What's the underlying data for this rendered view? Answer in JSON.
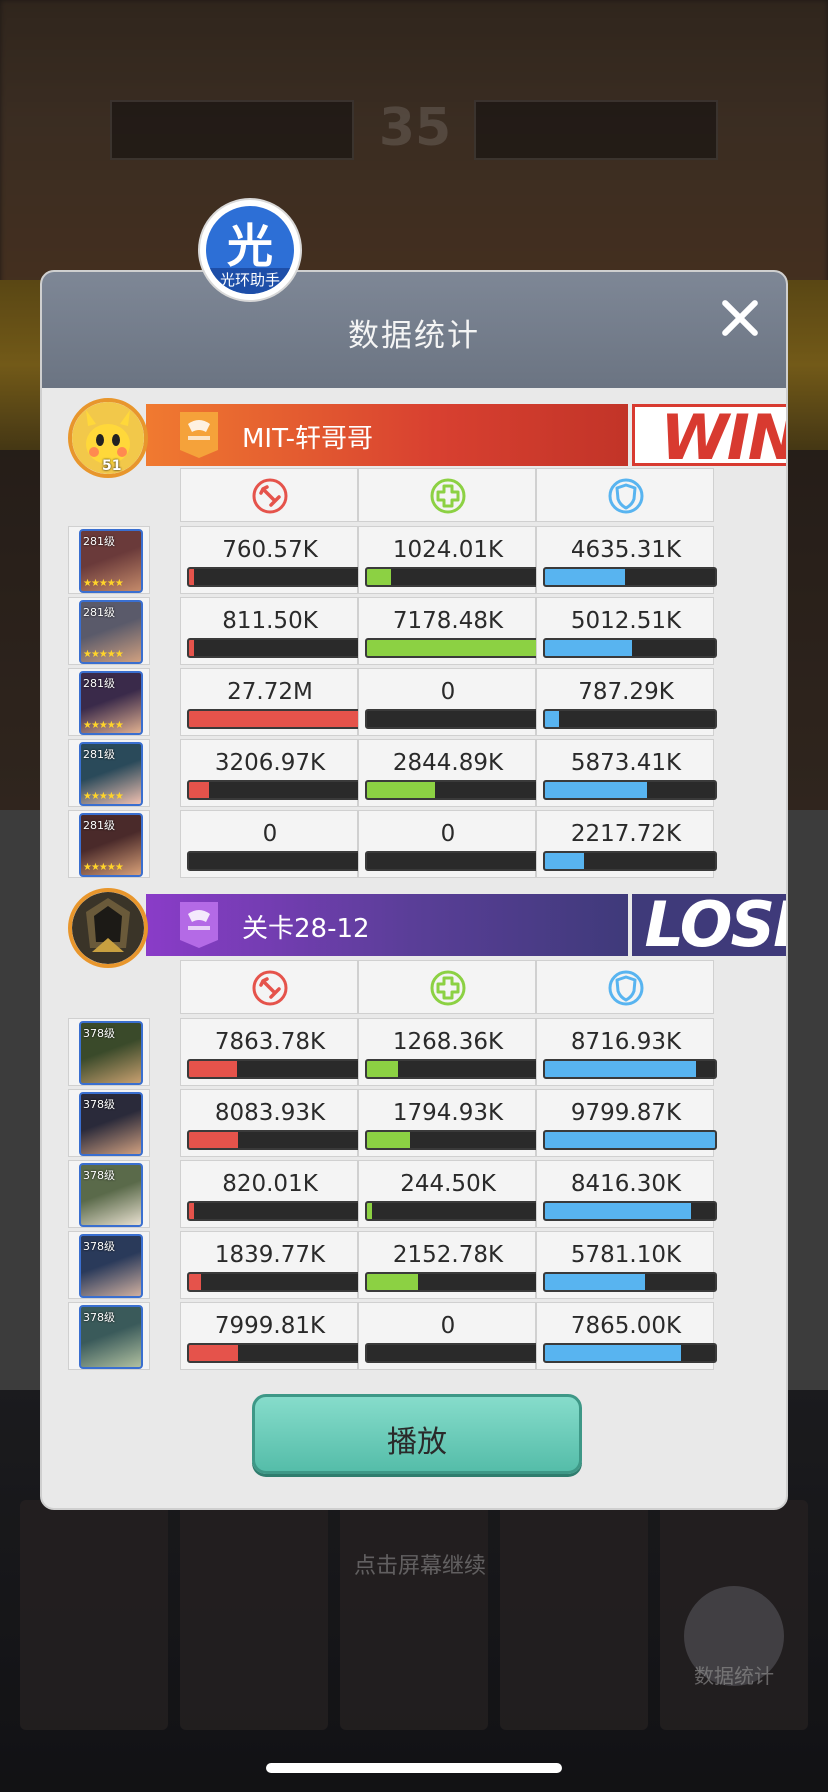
{
  "background": {
    "score": "35",
    "hint": "点击屏幕继续",
    "stats_button_label": "数据统计"
  },
  "badge": {
    "char": "光",
    "label": "光环助手"
  },
  "dialog": {
    "title": "数据统计"
  },
  "team1": {
    "name": "MIT-轩哥哥",
    "level": "51",
    "result": "WIN",
    "color": "#d84030",
    "rows": [
      {
        "level": "281级",
        "dmg": "760.57K",
        "dmg_frac": 0.03,
        "heal": "1024.01K",
        "heal_frac": 0.14,
        "def": "4635.31K",
        "def_frac": 0.47
      },
      {
        "level": "281级",
        "dmg": "811.50K",
        "dmg_frac": 0.03,
        "heal": "7178.48K",
        "heal_frac": 1.0,
        "def": "5012.51K",
        "def_frac": 0.51
      },
      {
        "level": "281级",
        "dmg": "27.72M",
        "dmg_frac": 1.0,
        "heal": "0",
        "heal_frac": 0,
        "def": "787.29K",
        "def_frac": 0.08
      },
      {
        "level": "281级",
        "dmg": "3206.97K",
        "dmg_frac": 0.12,
        "heal": "2844.89K",
        "heal_frac": 0.4,
        "def": "5873.41K",
        "def_frac": 0.6
      },
      {
        "level": "281级",
        "dmg": "0",
        "dmg_frac": 0,
        "heal": "0",
        "heal_frac": 0,
        "def": "2217.72K",
        "def_frac": 0.23
      }
    ]
  },
  "team2": {
    "name": "关卡28-12",
    "result": "LOSE",
    "color": "#3f3a7a",
    "rows": [
      {
        "level": "378级",
        "dmg": "7863.78K",
        "dmg_frac": 0.28,
        "heal": "1268.36K",
        "heal_frac": 0.18,
        "def": "8716.93K",
        "def_frac": 0.89
      },
      {
        "level": "378级",
        "dmg": "8083.93K",
        "dmg_frac": 0.29,
        "heal": "1794.93K",
        "heal_frac": 0.25,
        "def": "9799.87K",
        "def_frac": 1.0
      },
      {
        "level": "378级",
        "dmg": "820.01K",
        "dmg_frac": 0.03,
        "heal": "244.50K",
        "heal_frac": 0.03,
        "def": "8416.30K",
        "def_frac": 0.86
      },
      {
        "level": "378级",
        "dmg": "1839.77K",
        "dmg_frac": 0.07,
        "heal": "2152.78K",
        "heal_frac": 0.3,
        "def": "5781.10K",
        "def_frac": 0.59
      },
      {
        "level": "378级",
        "dmg": "7999.81K",
        "dmg_frac": 0.29,
        "heal": "0",
        "heal_frac": 0,
        "def": "7865.00K",
        "def_frac": 0.8
      }
    ]
  },
  "columns": {
    "damage_icon": "sword-icon",
    "heal_icon": "plus-cross-icon",
    "defense_icon": "shield-icon",
    "damage_color": "#e5534b",
    "heal_color": "#8cd143",
    "defense_color": "#58b4f0"
  },
  "play_button": {
    "label": "播放"
  }
}
